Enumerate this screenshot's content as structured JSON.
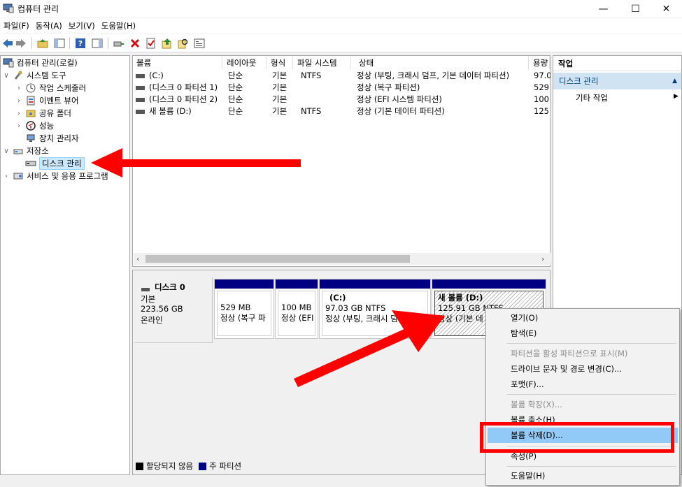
{
  "window": {
    "title": "컴퓨터 관리",
    "minimize": "—",
    "maximize": "☐",
    "close": "✕"
  },
  "menu": [
    "파일(F)",
    "동작(A)",
    "보기(V)",
    "도움말(H)"
  ],
  "toolbar_icons": [
    "back-arrow-icon",
    "forward-arrow-icon",
    "up-folder-icon",
    "show-hide-tree-icon",
    "help-icon",
    "show-hide-action-icon",
    "connect-icon",
    "delete-icon",
    "properties-icon",
    "export-icon",
    "find-icon",
    "view-icon"
  ],
  "tree": {
    "root": "컴퓨터 관리(로컬)",
    "system_tools": "시스템 도구",
    "task_scheduler": "작업 스케줄러",
    "event_viewer": "이벤트 뷰어",
    "shared_folders": "공유 폴더",
    "performance": "성능",
    "device_manager": "장치 관리자",
    "storage": "저장소",
    "disk_management": "디스크 관리",
    "services": "서비스 및 응용 프로그램"
  },
  "volume_table": {
    "columns": [
      "볼륨",
      "레이아웃",
      "형식",
      "파일 시스템",
      "상태",
      "용량"
    ],
    "rows": [
      {
        "volume": "(C:)",
        "layout": "단순",
        "type": "기본",
        "fs": "NTFS",
        "status": "정상 (부팅, 크래시 덤프, 기본 데이터 파티션)",
        "capacity": "97.0"
      },
      {
        "volume": "(디스크 0 파티션 1)",
        "layout": "단순",
        "type": "기본",
        "fs": "",
        "status": "정상 (복구 파티션)",
        "capacity": "529"
      },
      {
        "volume": "(디스크 0 파티션 2)",
        "layout": "단순",
        "type": "기본",
        "fs": "",
        "status": "정상 (EFI 시스템 파티션)",
        "capacity": "100"
      },
      {
        "volume": "새 볼륨 (D:)",
        "layout": "단순",
        "type": "기본",
        "fs": "NTFS",
        "status": "정상 (기본 데이터 파티션)",
        "capacity": "125"
      }
    ]
  },
  "disk": {
    "name": "디스크 0",
    "type": "기본",
    "size": "223.56 GB",
    "state": "온라인",
    "partitions": [
      {
        "title": "",
        "size": "529 MB",
        "status": "정상 (복구 파"
      },
      {
        "title": "",
        "size": "100 MB",
        "status": "정상 (EFI"
      },
      {
        "title": "(C:)",
        "size": "97.03 GB NTFS",
        "status": "정상 (부팅, 크래시 덤"
      },
      {
        "title": "새 볼륨  (D:)",
        "size": "125.91 GB NTFS",
        "status": "정상 (기본 데"
      }
    ]
  },
  "legend": {
    "unallocated": "할당되지 않음",
    "primary": "주 파티션"
  },
  "actions": {
    "header": "작업",
    "section": "디스크 관리",
    "other": "기타 작업"
  },
  "context_menu": {
    "open": "열기(O)",
    "explore": "탐색(E)",
    "mark_active": "파티션을 활성 파티션으로 표시(M)",
    "change_letter": "드라이브 문자 및 경로 변경(C)...",
    "format": "포맷(F)...",
    "extend": "볼륨 확장(X)...",
    "shrink": "볼륨 축소(H)",
    "delete": "볼륨 삭제(D)...",
    "properties": "속성(P)",
    "help": "도움말(H)"
  },
  "colors": {
    "partition_bar": "#000080",
    "annotation_red": "#ff0000",
    "highlight": "#91c9f7"
  }
}
